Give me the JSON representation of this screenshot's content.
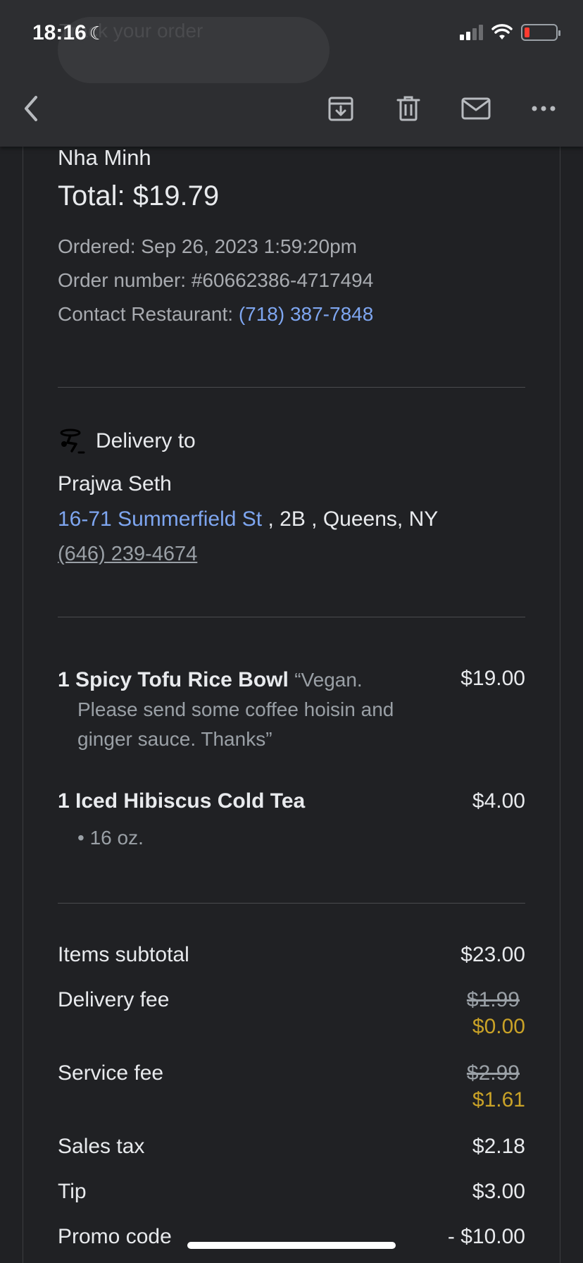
{
  "status_bar": {
    "time": "18:16"
  },
  "header": {
    "ghost_title": "Track your order"
  },
  "order": {
    "restaurant": "Nha Minh",
    "total": "Total: $19.79",
    "ordered_label": "Ordered: Sep 26, 2023 1:59:20pm",
    "order_number": "Order number: #60662386-4717494",
    "contact_label": "Contact Restaurant:",
    "contact_phone": "(718) 387-7848"
  },
  "delivery": {
    "heading": "Delivery to",
    "name": "Prajwa Seth",
    "street": "16-71 Summerfield St",
    "rest_of_address": " , 2B , Queens, NY",
    "phone": "(646) 239-4674"
  },
  "items": [
    {
      "name": "1 Spicy Tofu Rice Bowl",
      "note_line1": "“Vegan.",
      "note_line2": "Please send some coffee hoisin and",
      "note_line3": "ginger sauce. Thanks”",
      "price": "$19.00"
    },
    {
      "name": "1 Iced Hibiscus Cold Tea",
      "option": "• 16 oz.",
      "price": "$4.00"
    }
  ],
  "summary": {
    "subtotal_label": "Items subtotal",
    "subtotal": "$23.00",
    "delivery_label": "Delivery fee",
    "delivery_original": "$1.99",
    "delivery_final": "$0.00",
    "service_label": "Service fee",
    "service_original": "$2.99",
    "service_final": "$1.61",
    "tax_label": "Sales tax",
    "tax": "$2.18",
    "tip_label": "Tip",
    "tip": "$3.00",
    "promo_label": "Promo code",
    "promo": "- $10.00"
  },
  "colors": {
    "link": "#7ea6f0",
    "discount": "#c9a227",
    "background": "#202124"
  }
}
